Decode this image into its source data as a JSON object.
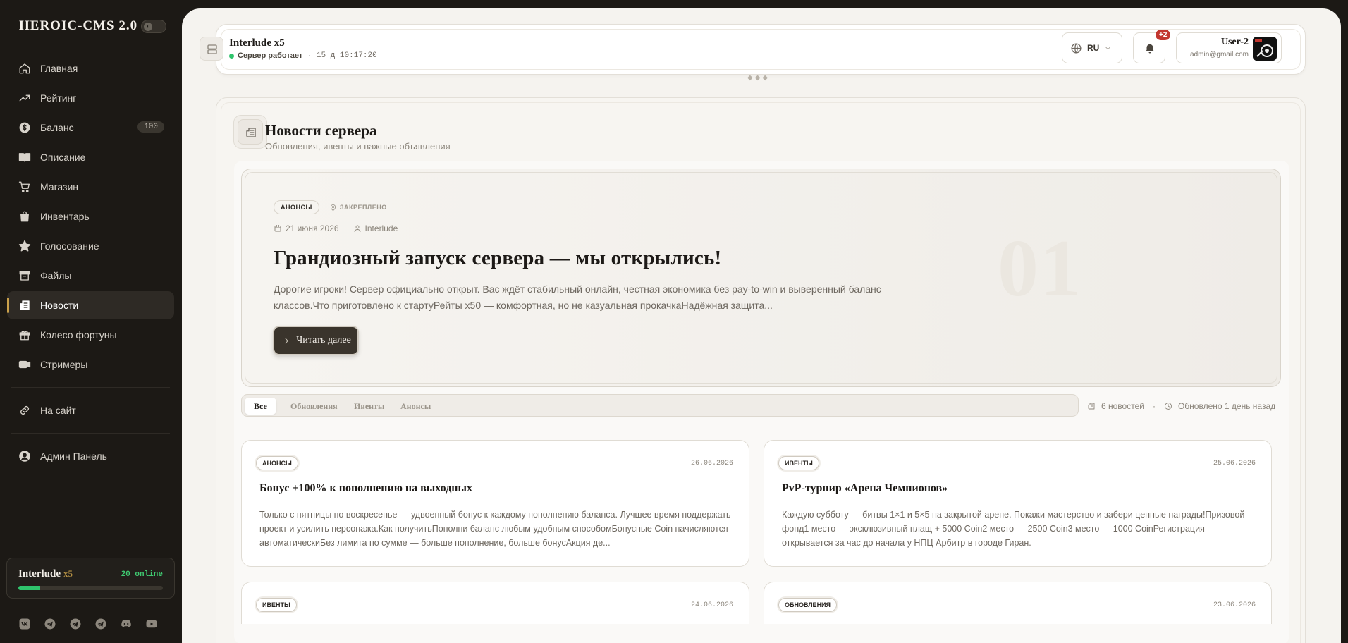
{
  "sidebar": {
    "brand": "HEROIC-CMS 2.0",
    "toggle_glyph": "◐",
    "items": [
      {
        "label": "Главная",
        "icon": "home-icon"
      },
      {
        "label": "Рейтинг",
        "icon": "trending-icon"
      },
      {
        "label": "Баланс",
        "icon": "coin-icon",
        "badge": "100"
      },
      {
        "label": "Описание",
        "icon": "book-icon"
      },
      {
        "label": "Магазин",
        "icon": "cart-icon"
      },
      {
        "label": "Инвентарь",
        "icon": "bag-icon"
      },
      {
        "label": "Голосование",
        "icon": "star-icon"
      },
      {
        "label": "Файлы",
        "icon": "archive-icon"
      },
      {
        "label": "Новости",
        "icon": "news-icon",
        "active": true
      },
      {
        "label": "Колесо фортуны",
        "icon": "gift-icon"
      },
      {
        "label": "Стримеры",
        "icon": "video-icon"
      }
    ],
    "site_link": "На сайт",
    "admin_link": "Админ Панель",
    "server_card": {
      "name": "Interlude",
      "rate": "x5",
      "online": "20 online",
      "online_fraction": 0.15
    },
    "socials": [
      "vk-icon",
      "telegram-icon",
      "telegram-icon",
      "telegram-icon",
      "discord-icon",
      "youtube-icon"
    ]
  },
  "topbar": {
    "server_title": "Interlude x5",
    "server_status": "Сервер работает",
    "separator": "·",
    "uptime": "15 д 10:17:20",
    "language": "RU",
    "notifications_badge": "+2",
    "user_name": "User-2",
    "user_email": "admin@gmail.com"
  },
  "news": {
    "title": "Новости сервера",
    "subtitle": "Обновления, ивенты и важные объявления",
    "hero": {
      "tag": "АНОНСЫ",
      "pinned": "ЗАКРЕПЛЕНО",
      "date": "21 июня 2026",
      "author": "Interlude",
      "title": "Грандиозный запуск сервера — мы открылись!",
      "text": "Дорогие игроки! Сервер официально открыт. Вас ждёт стабильный онлайн, честная экономика без pay-to-win и выверенный баланс классов.Что приготовлено к стартуРейты x50 — комфортная, но не казуальная прокачкаНадёжная защита...",
      "button": "Читать далее",
      "number": "01"
    },
    "filters": [
      "Все",
      "Обновления",
      "Ивенты",
      "Анонсы"
    ],
    "active_filter": "Все",
    "count_text": "6 новостей",
    "updated_text": "Обновлено 1 день назад",
    "cards": [
      {
        "tag": "АНОНСЫ",
        "date": "26.06.2026",
        "title": "Бонус +100% к пополнению на выходных",
        "text": "Только с пятницы по воскресенье — удвоенный бонус к каждому пополнению баланса. Лучшее время поддержать проект и усилить персонажа.Как получитьПополни баланс любым удобным способомБонусные Coin начисляются автоматическиБез лимита по сумме — больше пополнение, больше бонусАкция де..."
      },
      {
        "tag": "ИВЕНТЫ",
        "date": "25.06.2026",
        "title": "PvP-турнир «Арена Чемпионов»",
        "text": "Каждую субботу — битвы 1×1 и 5×5 на закрытой арене. Покажи мастерство и забери ценные награды!Призовой фонд1 место — эксклюзивный плащ + 5000 Coin2 место — 2500 Coin3 место — 1000 CoinРегистрация открывается за час до начала у НПЦ Арбитр в городе Гиран."
      },
      {
        "tag": "ИВЕНТЫ",
        "date": "24.06.2026",
        "title": "",
        "text": ""
      },
      {
        "tag": "ОБНОВЛЕНИЯ",
        "date": "23.06.2026",
        "title": "",
        "text": ""
      }
    ]
  },
  "colors": {
    "accent": "#c9a04a",
    "online": "#2fc46c",
    "badge": "#c2362f",
    "sidebar_bg": "#1c1915"
  }
}
